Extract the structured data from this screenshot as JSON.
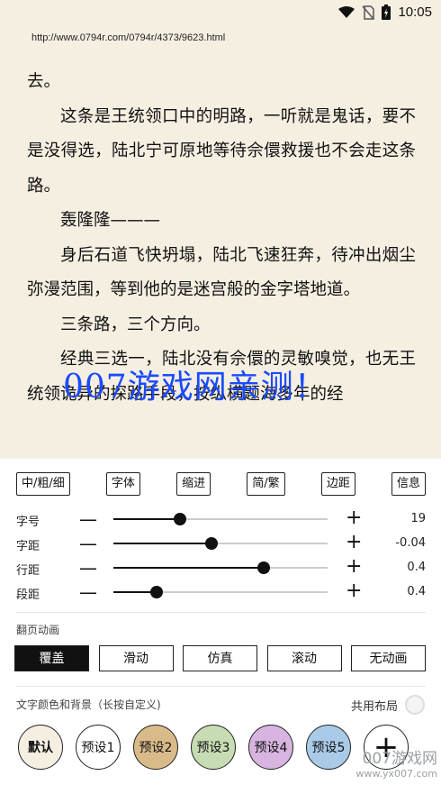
{
  "status": {
    "time": "10:05"
  },
  "url": "http://www.0794r.com/0794r/4373/9623.html",
  "reader": {
    "paragraphs": [
      {
        "text": "去。",
        "indent": false
      },
      {
        "text": "这条是王统领口中的明路，一听就是鬼话，要不是没得选，陆北宁可原地等待佘儇救援也不会走这条路。",
        "indent": true
      },
      {
        "text": "轰隆隆———",
        "indent": true
      },
      {
        "text": "身后石道飞快坍塌，陆北飞速狂奔，待冲出烟尘弥漫范围，等到他的是迷宫般的金字塔地道。",
        "indent": true
      },
      {
        "text": "三条路，三个方向。",
        "indent": true
      },
      {
        "text": "经典三选一，陆北没有佘儇的灵敏嗅觉，也无王统领诡异的探路手段，按纵横题海多年的经",
        "indent": true
      }
    ]
  },
  "watermark": "007游戏网亲测！",
  "panel": {
    "top_buttons": [
      "中/粗/细",
      "字体",
      "缩进",
      "简/繁",
      "边距",
      "信息"
    ],
    "sliders": [
      {
        "label": "字号",
        "value": "19",
        "position": 0.31
      },
      {
        "label": "字距",
        "value": "-0.04",
        "position": 0.46
      },
      {
        "label": "行距",
        "value": "0.4",
        "position": 0.7
      },
      {
        "label": "段距",
        "value": "0.4",
        "position": 0.2
      }
    ],
    "minus": "—",
    "plus": "+",
    "anim_title": "翻页动画",
    "anim_buttons": [
      "覆盖",
      "滑动",
      "仿真",
      "滚动",
      "无动画"
    ],
    "anim_selected": 0,
    "color_title": "文字颜色和背景（长按自定义)",
    "shared_layout": "共用布局",
    "themes": [
      {
        "label": "默认",
        "bg": "#f5efe2"
      },
      {
        "label": "预设1",
        "bg": "#ffffff"
      },
      {
        "label": "预设2",
        "bg": "#d9bb8a"
      },
      {
        "label": "预设3",
        "bg": "#c8dcb4"
      },
      {
        "label": "预设4",
        "bg": "#d8b5e0"
      },
      {
        "label": "预设5",
        "bg": "#a9cbe8"
      }
    ],
    "add_label": "+"
  },
  "corner_watermark": {
    "big": "007游戏网",
    "small": "www.yx007.com"
  }
}
